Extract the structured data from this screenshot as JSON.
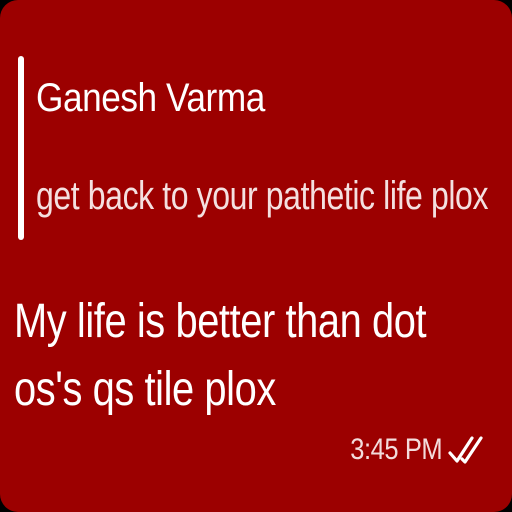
{
  "reply": {
    "sender": "Ganesh Varma",
    "text": "get back to your pathetic life plox"
  },
  "message": {
    "text": "My life is better than dot os's qs tile plox",
    "time": "3:45 PM",
    "status_icon": "double-check-icon"
  },
  "colors": {
    "bubble": "#9c0000",
    "text": "#ffffff",
    "quote_bar": "#ffffff"
  }
}
